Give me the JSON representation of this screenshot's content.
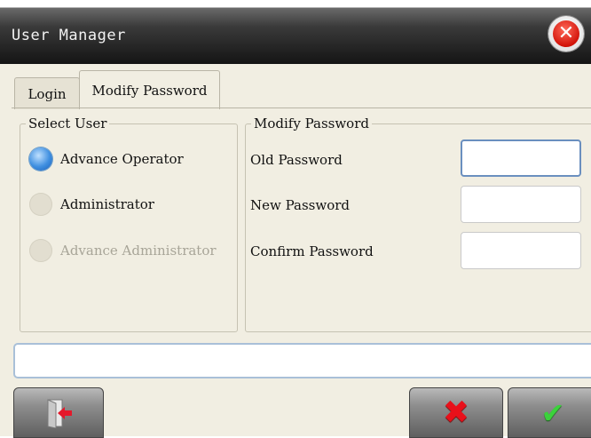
{
  "window": {
    "title": "User Manager",
    "close_icon": "close-icon"
  },
  "tabs": [
    {
      "label": "Login",
      "selected": false
    },
    {
      "label": "Modify Password",
      "selected": true
    }
  ],
  "select_user": {
    "legend": "Select User",
    "options": [
      {
        "label": "Advance Operator",
        "checked": true,
        "enabled": true
      },
      {
        "label": "Administrator",
        "checked": false,
        "enabled": true
      },
      {
        "label": "Advance Administrator",
        "checked": false,
        "enabled": false
      }
    ]
  },
  "modify_password": {
    "legend": "Modify Password",
    "old_label": "Old Password",
    "old_value": "",
    "new_label": "New Password",
    "new_value": "",
    "confirm_label": "Confirm Password",
    "confirm_value": ""
  },
  "status_text": "",
  "buttons": {
    "exit_icon": "exit-door-icon",
    "cancel_icon": "red-x-icon",
    "ok_icon": "green-check-icon"
  },
  "colors": {
    "radio_selected": "#3f8fe0",
    "cancel": "#e8101a",
    "confirm": "#3bd23b",
    "close": "#d3140a"
  }
}
